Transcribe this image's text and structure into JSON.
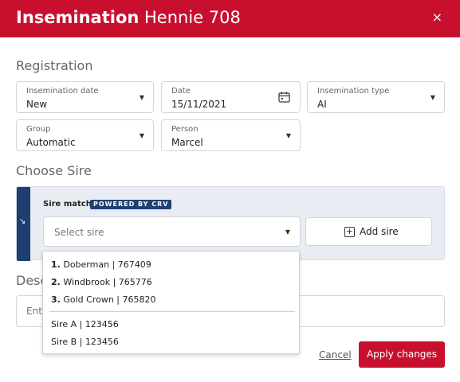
{
  "header": {
    "title_bold": "Insemination",
    "title_rest": "Hennie 708",
    "close_icon": "×"
  },
  "registration": {
    "section_title": "Registration",
    "fields": [
      {
        "label": "Insemination date",
        "value": "New",
        "icon": "chevron-down"
      },
      {
        "label": "Date",
        "value": "15/11/2021",
        "icon": "calendar"
      },
      {
        "label": "Insemination type",
        "value": "AI",
        "icon": "chevron-down"
      },
      {
        "label": "Group",
        "value": "Automatic",
        "icon": "chevron-down"
      },
      {
        "label": "Person",
        "value": "Marcel",
        "icon": "chevron-down"
      }
    ]
  },
  "choose_sire": {
    "section_title": "Choose Sire",
    "sire_match_label": "Sire match",
    "badge": "POWERED BY CRV",
    "select_placeholder": "Select sire",
    "add_sire_label": "Add sire",
    "dropdown": {
      "matches": [
        {
          "rank": "1.",
          "text": "Doberman | 767409"
        },
        {
          "rank": "2.",
          "text": "Windbrook | 765776"
        },
        {
          "rank": "3.",
          "text": "Gold Crown | 765820"
        }
      ],
      "others": [
        {
          "text": "Sire A | 123456"
        },
        {
          "text": "Sire B | 123456"
        }
      ]
    }
  },
  "description": {
    "section_title": "Desc",
    "placeholder": "Ente"
  },
  "actions": {
    "cancel_label": "Cancel",
    "apply_label": "Apply changes"
  },
  "colors": {
    "brand_red": "#c8102e",
    "crv_navy": "#1f3f72",
    "panel_bg": "#e9edf3"
  }
}
